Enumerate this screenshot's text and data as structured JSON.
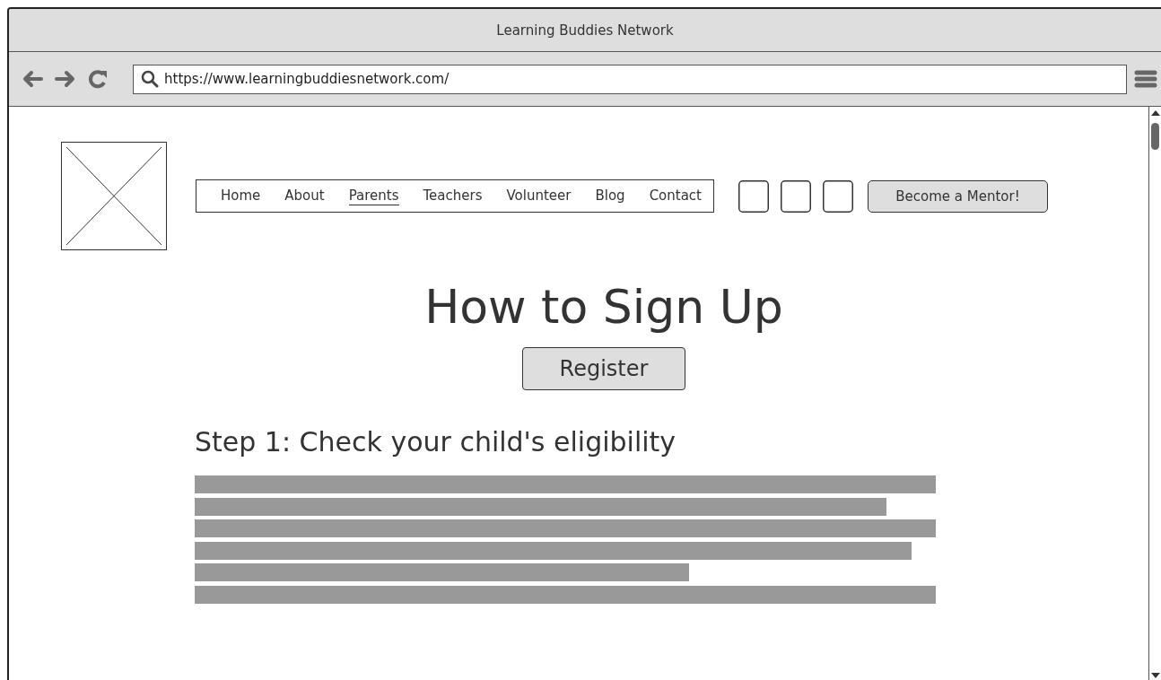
{
  "window": {
    "title": "Learning Buddies Network"
  },
  "address_bar": {
    "value": "https://www.learningbuddiesnetwork.com/"
  },
  "nav": {
    "items": [
      {
        "label": "Home",
        "selected": false
      },
      {
        "label": "About",
        "selected": false
      },
      {
        "label": "Parents",
        "selected": true
      },
      {
        "label": "Teachers",
        "selected": false
      },
      {
        "label": "Volunteer",
        "selected": false
      },
      {
        "label": "Blog",
        "selected": false
      },
      {
        "label": "Contact",
        "selected": false
      }
    ],
    "cta": "Become a Mentor!"
  },
  "heading": "How to Sign Up",
  "register_button": "Register",
  "step": {
    "title": "Step 1: Check your child's eligibility"
  }
}
